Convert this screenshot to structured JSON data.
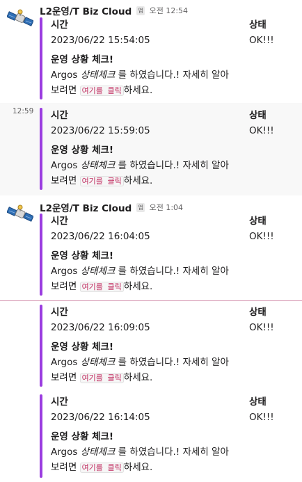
{
  "colors": {
    "attachment_bar": "#9b3de0",
    "new_message_divider": "#d18aa8",
    "inline_code": "#c02a5e"
  },
  "app": {
    "avatar_icon": "satellite-icon",
    "sender_name": "L2운영/T Biz Cloud",
    "app_badge": "앱"
  },
  "messages": [
    {
      "time": "오전 12:54",
      "fields": {
        "title_left": "시간",
        "value_left": "2023/06/22 15:54:05",
        "title_right": "상태",
        "value_right": "OK!!!"
      },
      "body": {
        "title": "운영 상황 체크!",
        "line1_pre": "Argos ",
        "line1_em": "상태체크",
        "line1_post": " 를 하였습니다.! 자세히 알아",
        "line2_pre": "보려면 ",
        "line2_link": "여기를 클릭",
        "line2_post": "하세요."
      }
    },
    {
      "hover_time": "12:59",
      "fields": {
        "title_left": "시간",
        "value_left": "2023/06/22 15:59:05",
        "title_right": "상태",
        "value_right": "OK!!!"
      },
      "body": {
        "title": "운영 상황 체크!",
        "line1_pre": "Argos ",
        "line1_em": "상태체크",
        "line1_post": " 를 하였습니다.! 자세히 알아",
        "line2_pre": "보려면 ",
        "line2_link": "여기를 클릭",
        "line2_post": "하세요."
      }
    },
    {
      "time": "오전 1:04",
      "fields": {
        "title_left": "시간",
        "value_left": "2023/06/22 16:04:05",
        "title_right": "상태",
        "value_right": "OK!!!"
      },
      "body": {
        "title": "운영 상황 체크!",
        "line1_pre": "Argos ",
        "line1_em": "상태체크",
        "line1_post": " 를 하였습니다.! 자세히 알아",
        "line2_pre": "보려면 ",
        "line2_link": "여기를 클릭",
        "line2_post": "하세요."
      }
    },
    {
      "fields": {
        "title_left": "시간",
        "value_left": "2023/06/22 16:09:05",
        "title_right": "상태",
        "value_right": "OK!!!"
      },
      "body": {
        "title": "운영 상황 체크!",
        "line1_pre": "Argos ",
        "line1_em": "상태체크",
        "line1_post": " 를 하였습니다.! 자세히 알아",
        "line2_pre": "보려면 ",
        "line2_link": "여기를 클릭",
        "line2_post": "하세요."
      }
    },
    {
      "fields": {
        "title_left": "시간",
        "value_left": "2023/06/22 16:14:05",
        "title_right": "상태",
        "value_right": "OK!!!"
      },
      "body": {
        "title": "운영 상황 체크!",
        "line1_pre": "Argos ",
        "line1_em": "상태체크",
        "line1_post": " 를 하였습니다.! 자세히 알아",
        "line2_pre": "보려면 ",
        "line2_link": "여기를 클릭",
        "line2_post": "하세요."
      }
    }
  ]
}
